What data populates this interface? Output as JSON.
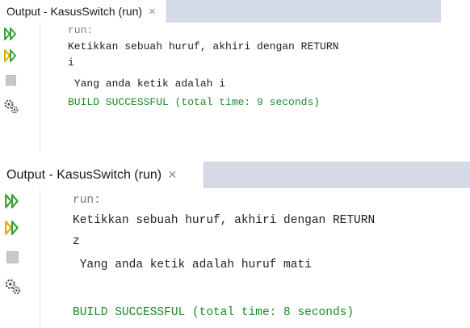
{
  "panels": [
    {
      "tab": {
        "title": "Output - KasusSwitch (run)",
        "close": "×"
      },
      "lines": [
        "run:",
        "Ketikkan sebuah huruf, akhiri dengan RETURN",
        "i",
        " Yang anda ketik adalah i",
        "BUILD SUCCESSFUL (total time: 9 seconds)"
      ]
    },
    {
      "tab": {
        "title": "Output - KasusSwitch (run)",
        "close": "×"
      },
      "lines": [
        "run:",
        "Ketikkan sebuah huruf, akhiri dengan RETURN",
        "z",
        " Yang anda ketik adalah huruf mati",
        "BUILD SUCCESSFUL (total time: 8 seconds)"
      ]
    }
  ],
  "icons": [
    "rerun-icon",
    "rerun-with-options-icon",
    "stop-icon",
    "settings-icon"
  ],
  "colors": {
    "success": "#1a8a2a",
    "tab_bar": "#d4dbe7",
    "rerun": "#3aa33a"
  }
}
